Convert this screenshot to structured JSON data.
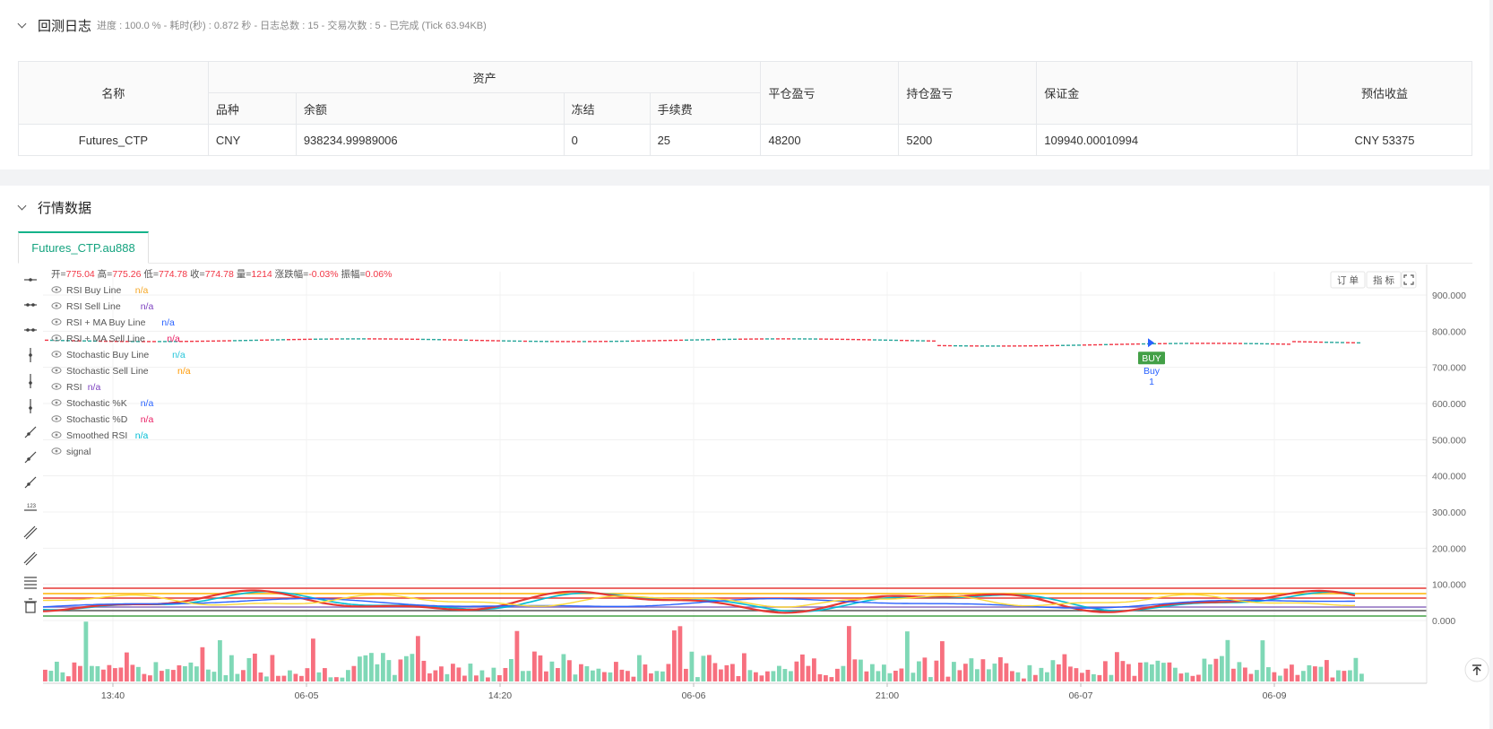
{
  "log_panel": {
    "title": "回测日志",
    "subtitle": "进度 : 100.0 % - 耗时(秒) : 0.872 秒 - 日志总数 : 15 - 交易次数 : 5 - 已完成 (Tick 63.94KB)"
  },
  "assets_table": {
    "headers": {
      "name": "名称",
      "assets": "资产",
      "variety": "品种",
      "balance": "余额",
      "frozen": "冻结",
      "fee": "手续费",
      "close_pnl": "平仓盈亏",
      "position_pnl": "持仓盈亏",
      "margin": "保证金",
      "est_profit": "预估收益"
    },
    "row": {
      "name": "Futures_CTP",
      "variety": "CNY",
      "balance": "938234.99989006",
      "frozen": "0",
      "fee": "25",
      "close_pnl": "48200",
      "position_pnl": "5200",
      "margin": "109940.00010994",
      "est_profit": "CNY 53375"
    }
  },
  "market_panel": {
    "title": "行情数据",
    "tab_label": "Futures_CTP.au888"
  },
  "chart_data": {
    "type": "candlestick",
    "ohlc": [
      {
        "label": "开",
        "value": "775.04"
      },
      {
        "label": "高",
        "value": "775.26"
      },
      {
        "label": "低",
        "value": "774.78"
      },
      {
        "label": "收",
        "value": "774.78"
      },
      {
        "label": "量",
        "value": "1214"
      },
      {
        "label": "涨跌幅",
        "value": "-0.03%"
      },
      {
        "label": "振幅",
        "value": "0.06%"
      }
    ],
    "legend": [
      {
        "name": "RSI Buy Line",
        "value": "n/a",
        "color": "#f5a623"
      },
      {
        "name": "RSI Sell Line",
        "value": "n/a",
        "color": "#7b3fbf"
      },
      {
        "name": "RSI + MA Buy Line",
        "value": "n/a",
        "color": "#2962ff"
      },
      {
        "name": "RSI + MA Sell Line",
        "value": "n/a",
        "color": "#e91e63"
      },
      {
        "name": "Stochastic Buy Line",
        "value": "n/a",
        "color": "#26c6da"
      },
      {
        "name": "Stochastic Sell Line",
        "value": "n/a",
        "color": "#ff9800"
      },
      {
        "name": "RSI",
        "value": "n/a",
        "color": "#7b3fbf"
      },
      {
        "name": "Stochastic %K",
        "value": "n/a",
        "color": "#2962ff"
      },
      {
        "name": "Stochastic %D",
        "value": "n/a",
        "color": "#e91e63"
      },
      {
        "name": "Smoothed RSI",
        "value": "n/a",
        "color": "#00bcd4"
      },
      {
        "name": "signal",
        "value": "",
        "color": "#666666"
      }
    ],
    "y_ticks": [
      "900.000",
      "800.000",
      "700.000",
      "600.000",
      "500.000",
      "400.000",
      "300.000",
      "200.000",
      "100.000",
      "0.000"
    ],
    "ylim": [
      0,
      900
    ],
    "x_ticks": [
      "13:40",
      "06-05",
      "14:20",
      "06-06",
      "21:00",
      "06-07",
      "06-09"
    ],
    "price_level": 775,
    "signal": {
      "label": "BUY",
      "text": "Buy",
      "count": "1",
      "price": 768
    },
    "toolbar_buttons": [
      "订 单",
      "指 标"
    ],
    "colors": {
      "up": "#26a69a",
      "down": "#f23645",
      "vol_up": "#7fd8b6",
      "vol_down": "#f7707f"
    }
  }
}
